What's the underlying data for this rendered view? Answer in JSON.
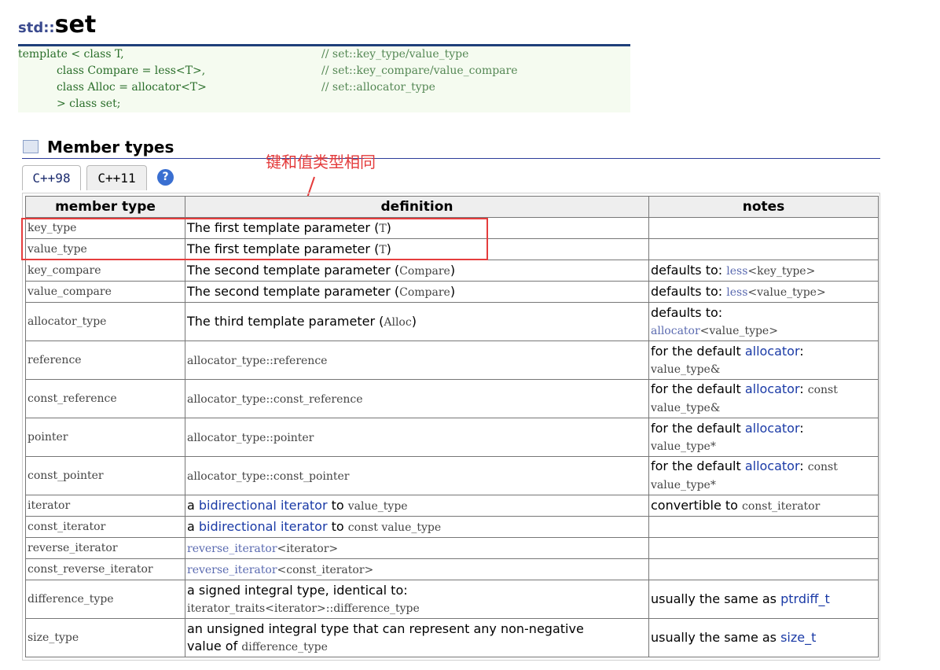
{
  "header": {
    "namespace": "std::",
    "name": "set"
  },
  "declaration": {
    "lines": [
      {
        "code": "template < class T,",
        "comment": "// set::key_type/value_type"
      },
      {
        "code": "           class Compare = less<T>,",
        "comment": "// set::key_compare/value_compare"
      },
      {
        "code": "           class Alloc = allocator<T>",
        "comment": "// set::allocator_type"
      },
      {
        "code": "           > class set;",
        "comment": ""
      }
    ]
  },
  "section": {
    "title": "Member types",
    "icon": "section-icon"
  },
  "tabs": [
    {
      "label": "C++98"
    },
    {
      "label": "C++11"
    }
  ],
  "help": {
    "label": "?"
  },
  "annotation": {
    "text": "键和值类型相同"
  },
  "table": {
    "headers": [
      "member type",
      "definition",
      "notes"
    ],
    "rows": [
      {
        "type": "key_type",
        "def": [
          {
            "t": "The first template parameter ("
          },
          {
            "t": "T",
            "c": "mono"
          },
          {
            "t": ")"
          }
        ],
        "notes": []
      },
      {
        "type": "value_type",
        "def": [
          {
            "t": "The first template parameter ("
          },
          {
            "t": "T",
            "c": "mono"
          },
          {
            "t": ")"
          }
        ],
        "notes": []
      },
      {
        "type": "key_compare",
        "def": [
          {
            "t": "The second template parameter ("
          },
          {
            "t": "Compare",
            "c": "mono"
          },
          {
            "t": ")"
          }
        ],
        "notes": [
          {
            "t": "defaults to: "
          },
          {
            "t": "less",
            "c": "monolnk"
          },
          {
            "t": "<key_type>",
            "c": "mono"
          }
        ]
      },
      {
        "type": "value_compare",
        "def": [
          {
            "t": "The second template parameter ("
          },
          {
            "t": "Compare",
            "c": "mono"
          },
          {
            "t": ")"
          }
        ],
        "notes": [
          {
            "t": "defaults to: "
          },
          {
            "t": "less",
            "c": "monolnk"
          },
          {
            "t": "<value_type>",
            "c": "mono"
          }
        ]
      },
      {
        "type": "allocator_type",
        "def": [
          {
            "t": "The third template parameter ("
          },
          {
            "t": "Alloc",
            "c": "mono"
          },
          {
            "t": ")"
          }
        ],
        "notes": [
          {
            "t": "defaults to:"
          },
          {
            "br": true
          },
          {
            "t": "allocator",
            "c": "monolnk"
          },
          {
            "t": "<value_type>",
            "c": "mono"
          }
        ]
      },
      {
        "type": "reference",
        "def": [
          {
            "t": "allocator_type::reference",
            "c": "mono"
          }
        ],
        "notes": [
          {
            "t": "for the default "
          },
          {
            "t": "allocator",
            "c": "lnk"
          },
          {
            "t": ":"
          },
          {
            "br": true
          },
          {
            "t": "value_type&",
            "c": "mono"
          }
        ]
      },
      {
        "type": "const_reference",
        "def": [
          {
            "t": "allocator_type::const_reference",
            "c": "mono"
          }
        ],
        "notes": [
          {
            "t": "for the default "
          },
          {
            "t": "allocator",
            "c": "lnk"
          },
          {
            "t": ": "
          },
          {
            "t": "const",
            "c": "mono"
          },
          {
            "br": true
          },
          {
            "t": "value_type&",
            "c": "mono"
          }
        ]
      },
      {
        "type": "pointer",
        "def": [
          {
            "t": "allocator_type::pointer",
            "c": "mono"
          }
        ],
        "notes": [
          {
            "t": "for the default "
          },
          {
            "t": "allocator",
            "c": "lnk"
          },
          {
            "t": ":"
          },
          {
            "br": true
          },
          {
            "t": "value_type*",
            "c": "mono"
          }
        ]
      },
      {
        "type": "const_pointer",
        "def": [
          {
            "t": "allocator_type::const_pointer",
            "c": "mono"
          }
        ],
        "notes": [
          {
            "t": "for the default "
          },
          {
            "t": "allocator",
            "c": "lnk"
          },
          {
            "t": ": "
          },
          {
            "t": "const",
            "c": "mono"
          },
          {
            "br": true
          },
          {
            "t": "value_type*",
            "c": "mono"
          }
        ]
      },
      {
        "type": "iterator",
        "def": [
          {
            "t": "a "
          },
          {
            "t": "bidirectional iterator",
            "c": "lnk"
          },
          {
            "t": " to "
          },
          {
            "t": "value_type",
            "c": "mono"
          }
        ],
        "notes": [
          {
            "t": "convertible to "
          },
          {
            "t": "const_iterator",
            "c": "mono"
          }
        ]
      },
      {
        "type": "const_iterator",
        "def": [
          {
            "t": "a "
          },
          {
            "t": "bidirectional iterator",
            "c": "lnk"
          },
          {
            "t": " to "
          },
          {
            "t": "const value_type",
            "c": "mono"
          }
        ],
        "notes": []
      },
      {
        "type": "reverse_iterator",
        "def": [
          {
            "t": "reverse_iterator",
            "c": "monolnk"
          },
          {
            "t": "<iterator>",
            "c": "mono"
          }
        ],
        "notes": []
      },
      {
        "type": "const_reverse_iterator",
        "def": [
          {
            "t": "reverse_iterator",
            "c": "monolnk"
          },
          {
            "t": "<const_iterator>",
            "c": "mono"
          }
        ],
        "notes": []
      },
      {
        "type": "difference_type",
        "def": [
          {
            "t": "a signed integral type, identical to:"
          },
          {
            "br": true
          },
          {
            "t": "iterator_traits<iterator>::difference_type",
            "c": "mono"
          }
        ],
        "notes": [
          {
            "t": "usually the same as "
          },
          {
            "t": "ptrdiff_t",
            "c": "lnk"
          }
        ]
      },
      {
        "type": "size_type",
        "def": [
          {
            "t": "an unsigned integral type that can represent any non-negative"
          },
          {
            "br": true
          },
          {
            "t": "value of "
          },
          {
            "t": "difference_type",
            "c": "mono"
          }
        ],
        "notes": [
          {
            "t": "usually the same as "
          },
          {
            "t": "size_t",
            "c": "lnk"
          }
        ]
      }
    ]
  },
  "colors": {
    "highlight_box": "#e53d3d",
    "annotation": "#e43a3a",
    "link": "#1a3aa6"
  }
}
